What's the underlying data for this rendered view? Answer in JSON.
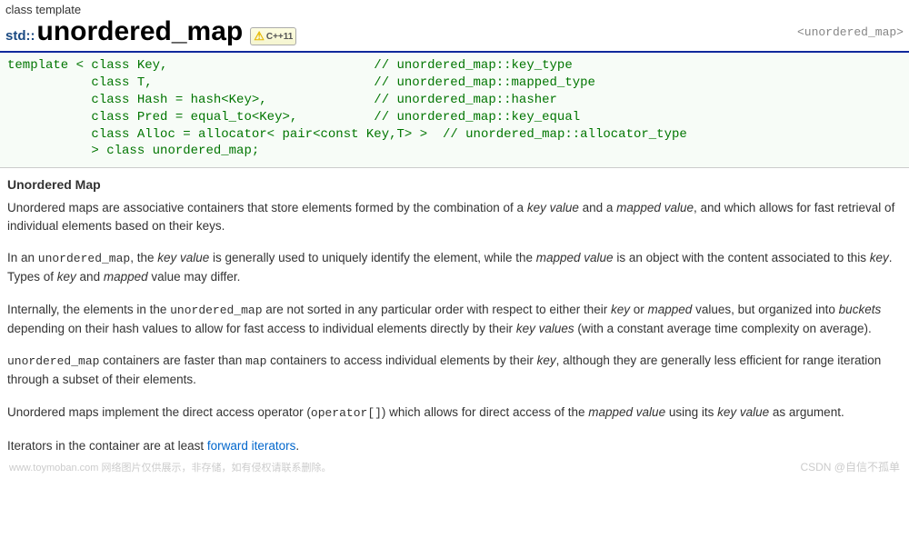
{
  "header": {
    "subtitle": "class template",
    "namespace": "std::",
    "title": "unordered_map",
    "badge": "C++11",
    "breadcrumb": "<unordered_map>"
  },
  "code": {
    "l1a": "template < ",
    "l1b": "class",
    "l1c": " Key,",
    "l1cm": "// unordered_map::key_type",
    "l2a": "           ",
    "l2b": "class",
    "l2c": " T,",
    "l2cm": "// unordered_map::mapped_type",
    "l3a": "           ",
    "l3b": "class",
    "l3c": " Hash = hash<Key>,",
    "l3cm": "// unordered_map::hasher",
    "l4a": "           ",
    "l4b": "class",
    "l4c": " Pred = equal_to<Key>,",
    "l4cm": "// unordered_map::key_equal",
    "l5a": "           ",
    "l5b": "class",
    "l5c": " Alloc = allocator< pair<",
    "l5d": "const",
    "l5e": " Key,T> >",
    "l5cm": "// unordered_map::allocator_type",
    "l6a": "           > ",
    "l6b": "class",
    "l6c": " unordered_map;"
  },
  "section": {
    "title": "Unordered Map"
  },
  "p1": {
    "t1": "Unordered maps are associative containers that store elements formed by the combination of a ",
    "e1": "key value",
    "t2": " and a ",
    "e2": "mapped value",
    "t3": ", and which allows for fast retrieval of individual elements based on their keys."
  },
  "p2": {
    "t1": "In an ",
    "m1": "unordered_map",
    "t2": ", the ",
    "e1": "key value",
    "t3": " is generally used to uniquely identify the element, while the ",
    "e2": "mapped value",
    "t4": " is an object with the content associated to this ",
    "e3": "key",
    "t5": ". Types of ",
    "e4": "key",
    "t6": " and ",
    "e5": "mapped",
    "t7": " value may differ."
  },
  "p3": {
    "t1": "Internally, the elements in the ",
    "m1": "unordered_map",
    "t2": " are not sorted in any particular order with respect to either their ",
    "e1": "key",
    "t3": " or ",
    "e2": "mapped",
    "t4": " values, but organized into ",
    "e3": "buckets",
    "t5": " depending on their hash values to allow for fast access to individual elements directly by their ",
    "e4": "key values",
    "t6": " (with a constant average time complexity on average)."
  },
  "p4": {
    "m1": "unordered_map",
    "t1": " containers are faster than ",
    "m2": "map",
    "t2": " containers to access individual elements by their ",
    "e1": "key",
    "t3": ", although they are generally less efficient for range iteration through a subset of their elements."
  },
  "p5": {
    "t1": "Unordered maps implement the direct access operator (",
    "m1": "operator[]",
    "t2": ") which allows for direct access of the ",
    "e1": "mapped value",
    "t3": " using its ",
    "e2": "key value",
    "t4": " as argument."
  },
  "p6": {
    "t1": "Iterators in the container are at least ",
    "l1": "forward iterators",
    "t2": "."
  },
  "watermark": {
    "bl": "www.toymoban.com 网络图片仅供展示，非存储，如有侵权请联系删除。",
    "br": "CSDN @自信不孤单"
  }
}
